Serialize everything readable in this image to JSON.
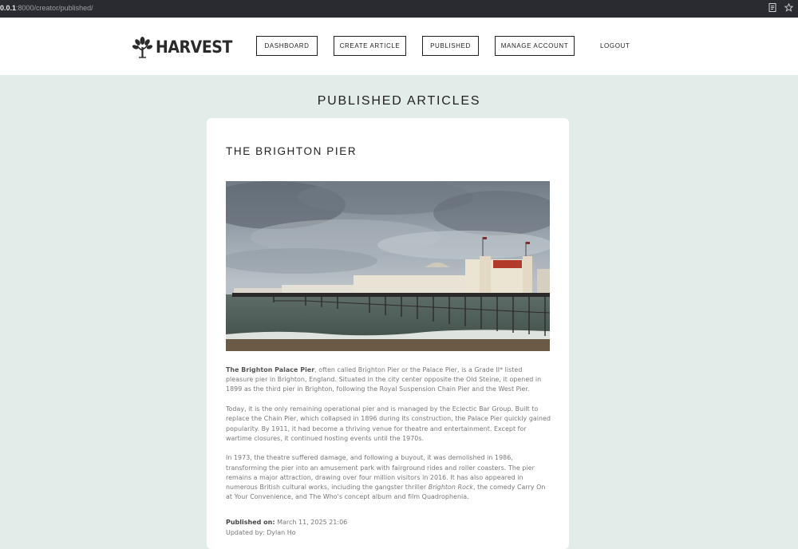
{
  "browser": {
    "url_host": "0.0.1",
    "url_path": ":8000/creator/published/"
  },
  "header": {
    "logo_text": "HARVEST",
    "nav": {
      "dashboard": "DASHBOARD",
      "create_article": "CREATE ARTICLE",
      "published": "PUBLISHED",
      "manage_account": "MANAGE ACCOUNT",
      "logout": "LOGOUT"
    }
  },
  "page": {
    "title": "PUBLISHED ARTICLES"
  },
  "article": {
    "title": "THE BRIGHTON PIER",
    "paragraph1": {
      "bold": "The Brighton Palace Pier",
      "rest": ", often called Brighton Pier or the Palace Pier, is a Grade II* listed pleasure pier in Brighton, England. Situated in the city center opposite the Old Steine, it opened in 1899 as the third pier in Brighton, following the Royal Suspension Chain Pier and the West Pier."
    },
    "paragraph2": "Today, it is the only remaining operational pier and is managed by the Eclectic Bar Group. Built to replace the Chain Pier, which collapsed in 1896 during its construction, the Palace Pier quickly gained popularity. By 1911, it had become a thriving venue for theatre and entertainment. Except for wartime closures, it continued hosting events until the 1970s.",
    "paragraph3": {
      "before": "In 1973, the theatre suffered damage, and following a buyout, it was demolished in 1986, transforming the pier into an amusement park with fairground rides and roller coasters. The pier remains a major attraction, drawing over four million visitors in 2016. It has also appeared in numerous British cultural works, including the gangster thriller ",
      "italic": "Brighton Rock",
      "after": ", the comedy Carry On at Your Convenience, and The Who's concept album and film Quadrophenia."
    },
    "published_label": "Published on:",
    "published_value": "March 11, 2025 21:06",
    "updated_label": "Updated by:",
    "updated_value": "Dylan Ho"
  }
}
